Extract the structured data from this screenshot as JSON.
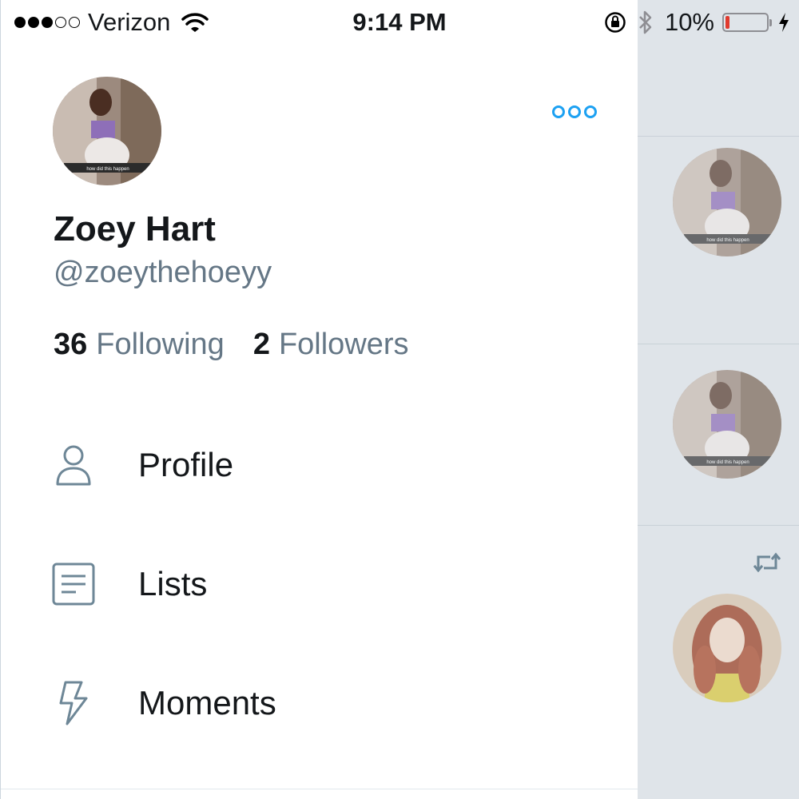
{
  "status_bar": {
    "carrier": "Verizon",
    "signal_bars_filled": 3,
    "signal_bars_total": 5,
    "time": "9:14 PM",
    "battery_percent": "10%",
    "battery_level": 0.1,
    "battery_color": "#e03a2e"
  },
  "profile": {
    "name": "Zoey Hart",
    "handle": "@zoeythehoeyy",
    "avatar_caption": "how did this happen",
    "following_count": "36",
    "following_label": "Following",
    "followers_count": "2",
    "followers_label": "Followers"
  },
  "menu": [
    {
      "label": "Profile",
      "icon": "person-icon"
    },
    {
      "label": "Lists",
      "icon": "list-icon"
    },
    {
      "label": "Moments",
      "icon": "lightning-icon"
    }
  ],
  "colors": {
    "accent": "#1da1f2",
    "secondary_text": "#657786",
    "primary_text": "#14171a",
    "timeline_background": "#dfe4e9"
  },
  "timeline_preview": {
    "avatar_caption": "how did this happen",
    "icons": [
      "retweet-icon"
    ]
  }
}
